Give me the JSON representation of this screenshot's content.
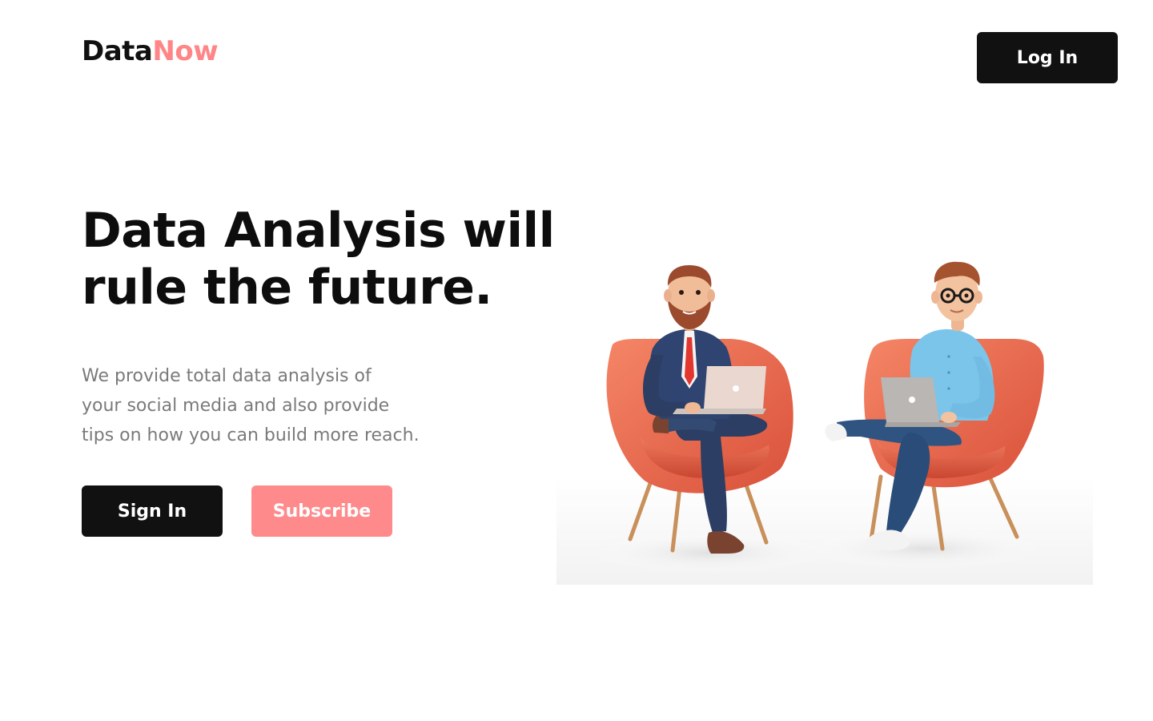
{
  "header": {
    "logo_part_a": "Data",
    "logo_part_b": "Now",
    "login_label": "Log In"
  },
  "hero": {
    "title_line_1": "Data Analysis will",
    "title_line_2": "rule the future.",
    "desc_line_1": "We provide total data analysis of",
    "desc_line_2": "your social media and also provide",
    "desc_line_3": "tips on how you can build more reach.",
    "signin_label": "Sign In",
    "subscribe_label": "Subscribe"
  },
  "colors": {
    "accent": "#ff8587",
    "dark": "#111111",
    "body_text": "#7a7a7a",
    "chair": "#ef6a4e"
  },
  "illustration": {
    "icon": "two-people-on-armchairs-with-laptops-illustration"
  }
}
